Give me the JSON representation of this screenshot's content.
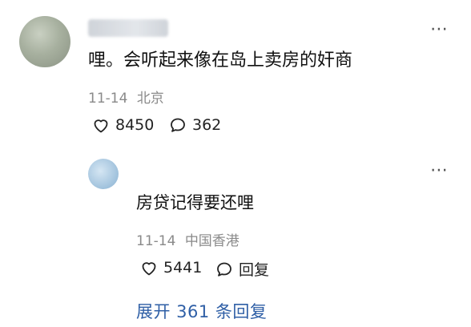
{
  "comment": {
    "username": "",
    "text": "哩。会听起来像在岛上卖房的奸商",
    "date": "11-14",
    "location": "北京",
    "likes": "8450",
    "replies": "362"
  },
  "reply": {
    "text": "房贷记得要还哩",
    "date": "11-14",
    "location": "中国香港",
    "likes": "5441",
    "reply_label": "回复"
  },
  "expand_label": "展开 361 条回复",
  "icons": {
    "more": "more-dots-icon",
    "like": "heart-outline-icon",
    "comment": "speech-bubble-icon"
  }
}
